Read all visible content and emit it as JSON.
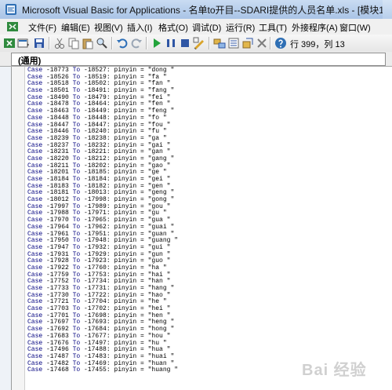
{
  "window": {
    "title": "Microsoft Visual Basic for Applications - 名单to开目--SDARI提供的人员名单.xls - [模块1 (代码)]"
  },
  "menu": [
    "文件(F)",
    "编辑(E)",
    "视图(V)",
    "插入(I)",
    "格式(O)",
    "调试(D)",
    "运行(R)",
    "工具(T)",
    "外接程序(A)",
    "窗口(W)"
  ],
  "toolbar": {
    "position": "行 399，列 13"
  },
  "combo": {
    "value": "(通用)"
  },
  "code_lines": [
    "Case -18773 To -18527: pinyin = \"dong \"",
    "Case -18526 To -18519: pinyin = \"fa \"",
    "Case -18518 To -18502: pinyin = \"fan \"",
    "Case -18501 To -18491: pinyin = \"fang \"",
    "Case -18490 To -18479: pinyin = \"fei \"",
    "Case -18478 To -18464: pinyin = \"fen \"",
    "Case -18463 To -18449: pinyin = \"feng \"",
    "Case -18448 To -18448: pinyin = \"fo \"",
    "Case -18447 To -18447: pinyin = \"fou \"",
    "Case -18446 To -18240: pinyin = \"fu \"",
    "Case -18239 To -18238: pinyin = \"ga \"",
    "Case -18237 To -18232: pinyin = \"gai \"",
    "Case -18231 To -18221: pinyin = \"gan \"",
    "Case -18220 To -18212: pinyin = \"gang \"",
    "Case -18211 To -18202: pinyin = \"gao \"",
    "Case -18201 To -18185: pinyin = \"ge \"",
    "Case -18184 To -18184: pinyin = \"gei \"",
    "Case -18183 To -18182: pinyin = \"gen \"",
    "Case -18181 To -18013: pinyin = \"geng \"",
    "Case -18012 To -17998: pinyin = \"gong \"",
    "Case -17997 To -17989: pinyin = \"gou \"",
    "Case -17988 To -17971: pinyin = \"gu \"",
    "Case -17970 To -17965: pinyin = \"gua \"",
    "Case -17964 To -17962: pinyin = \"guai \"",
    "Case -17961 To -17951: pinyin = \"guan \"",
    "Case -17950 To -17948: pinyin = \"guang \"",
    "Case -17947 To -17932: pinyin = \"gui \"",
    "Case -17931 To -17929: pinyin = \"gun \"",
    "Case -17928 To -17923: pinyin = \"guo \"",
    "Case -17922 To -17760: pinyin = \"ha \"",
    "Case -17759 To -17753: pinyin = \"hai \"",
    "Case -17752 To -17734: pinyin = \"han \"",
    "Case -17733 To -17731: pinyin = \"hang \"",
    "Case -17730 To -17722: pinyin = \"hao \"",
    "Case -17721 To -17704: pinyin = \"he \"",
    "Case -17703 To -17702: pinyin = \"hei \"",
    "Case -17701 To -17698: pinyin = \"hen \"",
    "Case -17697 To -17693: pinyin = \"heng \"",
    "Case -17692 To -17684: pinyin = \"hong \"",
    "Case -17683 To -17677: pinyin = \"hou \"",
    "Case -17676 To -17497: pinyin = \"hu \"",
    "Case -17496 To -17488: pinyin = \"hua \"",
    "Case -17487 To -17483: pinyin = \"huai \"",
    "Case -17482 To -17469: pinyin = \"huan \"",
    "Case -17468 To -17455: pinyin = \"huang \""
  ],
  "watermark": "Bai 经验",
  "icons": {
    "appicon": "vba-app-icon",
    "sysicon": "excel-view-icon"
  }
}
